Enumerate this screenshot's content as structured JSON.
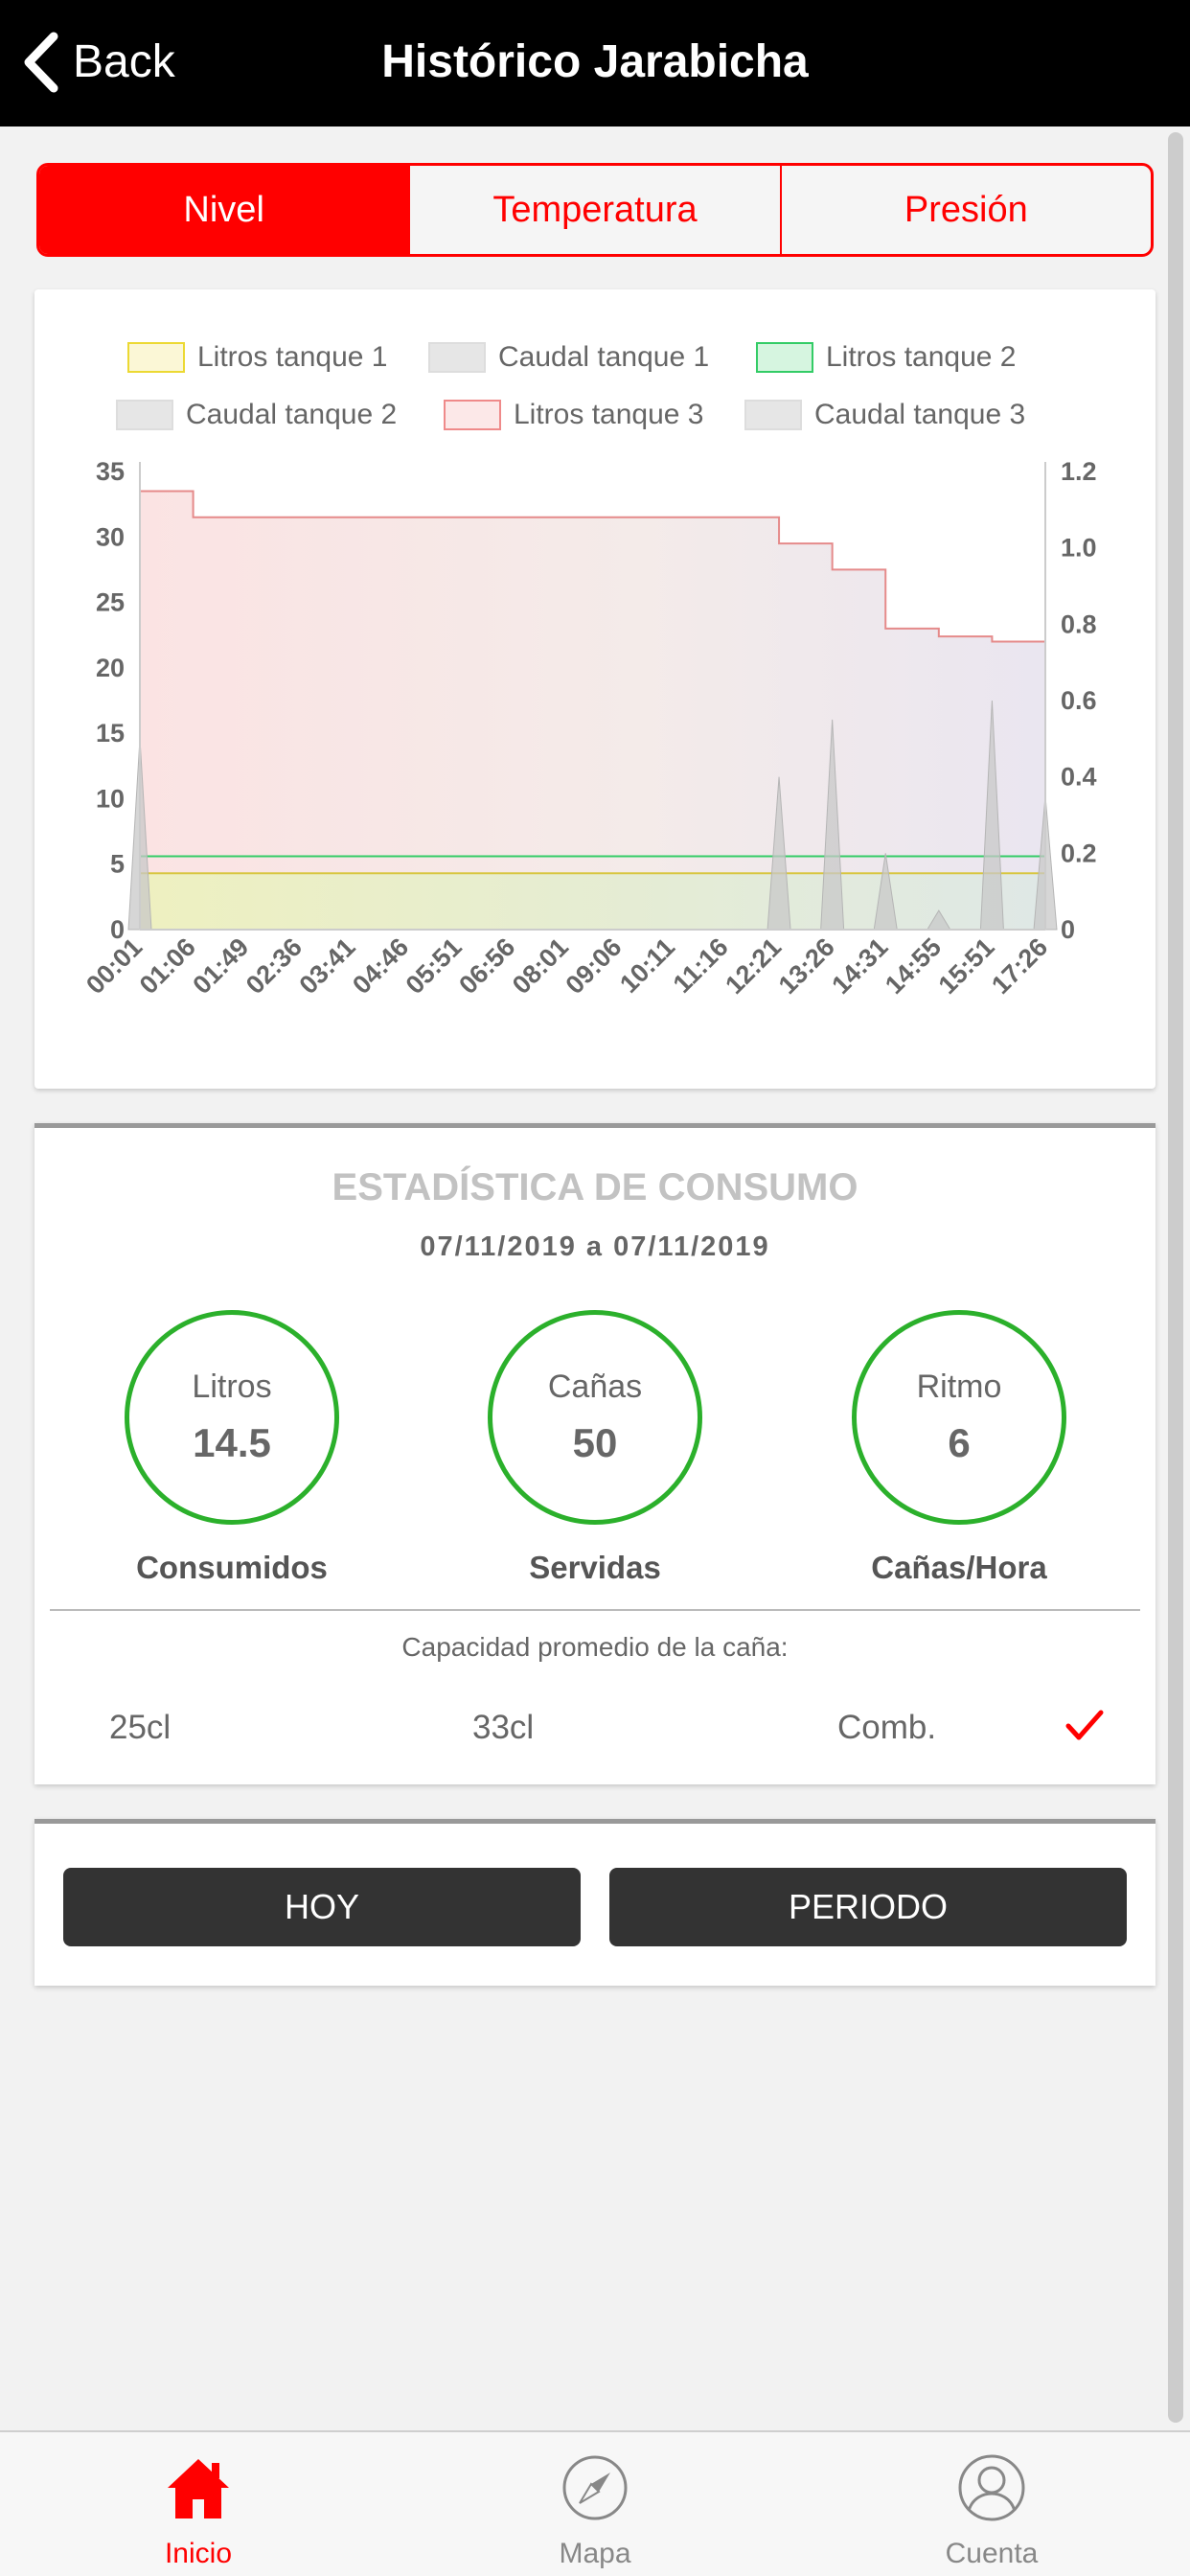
{
  "header": {
    "back_label": "Back",
    "title": "Histórico Jarabicha"
  },
  "tabs": [
    {
      "label": "Nivel",
      "active": true
    },
    {
      "label": "Temperatura",
      "active": false
    },
    {
      "label": "Presión",
      "active": false
    }
  ],
  "chart_data": {
    "type": "area",
    "legend": [
      "Litros tanque 1",
      "Caudal tanque 1",
      "Litros tanque 2",
      "Caudal tanque 2",
      "Litros tanque 3",
      "Caudal tanque 3"
    ],
    "legend_colors": [
      "#ecd933",
      "#cccccc",
      "#33cc66",
      "#cccccc",
      "#ef8a8a",
      "#cccccc"
    ],
    "legend_placement": "top",
    "x": [
      "00:01",
      "01:06",
      "01:49",
      "02:36",
      "03:41",
      "04:46",
      "05:51",
      "06:56",
      "08:01",
      "09:06",
      "10:11",
      "11:16",
      "12:21",
      "13:26",
      "14:31",
      "14:55",
      "15:51",
      "17:26"
    ],
    "y_left_ticks": [
      "0",
      "5",
      "10",
      "15",
      "20",
      "25",
      "30",
      "35"
    ],
    "y_right_ticks": [
      "0",
      "0.2",
      "0.4",
      "0.6",
      "0.8",
      "1.0",
      "1.2"
    ],
    "ylim_left": [
      0,
      35
    ],
    "ylim_right": [
      0,
      1.2
    ],
    "grid": false,
    "series": [
      {
        "name": "Litros tanque 1",
        "axis": "left",
        "values": [
          4.3,
          4.3,
          4.3,
          4.3,
          4.3,
          4.3,
          4.3,
          4.3,
          4.3,
          4.3,
          4.3,
          4.3,
          4.3,
          4.3,
          4.3,
          4.3,
          4.3,
          4.3
        ]
      },
      {
        "name": "Litros tanque 2",
        "axis": "left",
        "values": [
          5.6,
          5.6,
          5.6,
          5.6,
          5.6,
          5.6,
          5.6,
          5.6,
          5.6,
          5.6,
          5.6,
          5.6,
          5.6,
          5.6,
          5.6,
          5.6,
          5.6,
          5.6
        ]
      },
      {
        "name": "Litros tanque 3",
        "axis": "left",
        "values": [
          33.5,
          31.5,
          31.5,
          31.5,
          31.5,
          31.5,
          31.5,
          31.5,
          31.5,
          31.5,
          31.5,
          31.5,
          29.5,
          27.5,
          23.0,
          22.4,
          22.0,
          20.7
        ]
      },
      {
        "name": "Caudal tanque",
        "axis": "right",
        "values": [
          0.5,
          0,
          0,
          0,
          0,
          0,
          0,
          0,
          0,
          0,
          0,
          0,
          0.4,
          0.55,
          0.2,
          0.05,
          0.6,
          0.35
        ]
      }
    ]
  },
  "stats": {
    "title": "ESTADÍSTICA DE CONSUMO",
    "date_range": "07/11/2019 a 07/11/2019",
    "circles": [
      {
        "label": "Litros",
        "value": "14.5",
        "caption": "Consumidos"
      },
      {
        "label": "Cañas",
        "value": "50",
        "caption": "Servidas"
      },
      {
        "label": "Ritmo",
        "value": "6",
        "caption": "Cañas/Hora"
      }
    ],
    "capacity_label": "Capacidad promedio de la caña:",
    "options": [
      "25cl",
      "33cl",
      "Comb."
    ],
    "selected_option": "Comb.",
    "accent": "#2bb02b"
  },
  "buttons": {
    "today": "HOY",
    "period": "PERIODO"
  },
  "nav": [
    {
      "label": "Inicio",
      "icon": "home-icon",
      "active": true
    },
    {
      "label": "Mapa",
      "icon": "compass-icon",
      "active": false
    },
    {
      "label": "Cuenta",
      "icon": "user-icon",
      "active": false
    }
  ],
  "colors": {
    "brand": "#ff0000",
    "header_bg": "#000000",
    "button_bg": "#333333"
  }
}
